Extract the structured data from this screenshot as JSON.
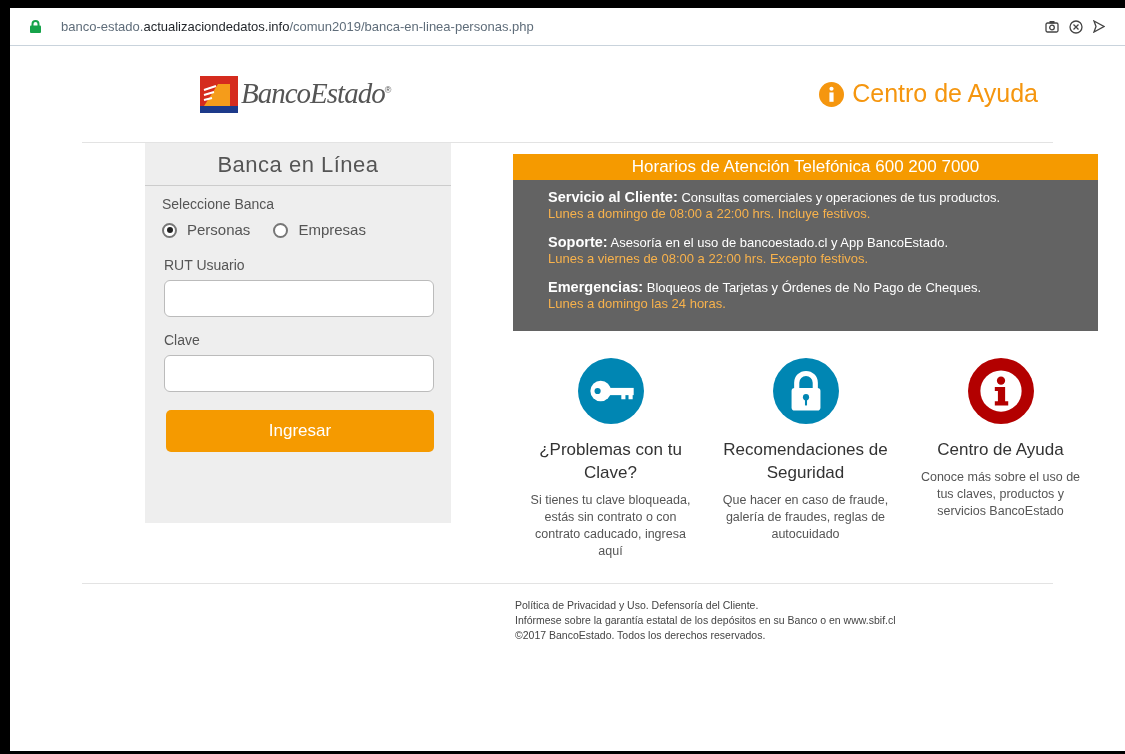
{
  "address_bar": {
    "secure": true,
    "url": [
      {
        "text": "banco-estado.",
        "emphasis": false
      },
      {
        "text": "actualizaciondedatos.info",
        "emphasis": true
      },
      {
        "text": "/comun2019/banca-en-linea-personas.php",
        "emphasis": false
      }
    ]
  },
  "header": {
    "logo_text": "BancoEstado",
    "logo_mark": "®",
    "help_link": "Centro de Ayuda"
  },
  "login": {
    "title": "Banca en Línea",
    "bank_label": "Seleccione Banca",
    "options": [
      {
        "label": "Personas",
        "selected": true
      },
      {
        "label": "Empresas",
        "selected": false
      }
    ],
    "fields": [
      {
        "label": "RUT Usuario"
      },
      {
        "label": "Clave"
      }
    ],
    "submit": "Ingresar"
  },
  "hours": {
    "title": "Horarios de Atención Telefónica 600 200 7000",
    "items": [
      {
        "name": "Servicio al Cliente:",
        "text": "Consultas comerciales y operaciones de tus productos.",
        "schedule": "Lunes a domingo de 08:00 a 22:00 hrs. Incluye festivos."
      },
      {
        "name": "Soporte:",
        "text": "Asesoría en el uso de bancoestado.cl y App BancoEstado.",
        "schedule": "Lunes a viernes de 08:00 a 22:00 hrs. Excepto festivos."
      },
      {
        "name": "Emergencias:",
        "text": "Bloqueos de Tarjetas y Órdenes de No Pago de Cheques.",
        "schedule": "Lunes a domingo las 24 horas."
      }
    ]
  },
  "features": [
    {
      "kind": "key",
      "color": "#0086b3",
      "title": "¿Problemas con tu Clave?",
      "text": "Si tienes tu clave bloqueada, estás sin contrato o con contrato caducado, ingresa aquí"
    },
    {
      "kind": "lock",
      "color": "#0086b3",
      "title": "Recomendaciones de Seguridad",
      "text": "Que hacer en caso de fraude, galería de fraudes, reglas de autocuidado"
    },
    {
      "kind": "info",
      "color": "#b30000",
      "title": "Centro de Ayuda",
      "text": "Conoce más sobre el uso de tus claves, productos y servicios BancoEstado"
    }
  ],
  "footer": [
    "Política de Privacidad y Uso. Defensoría del Cliente.",
    "Infórmese sobre la garantía estatal de los depósitos en su Banco o en www.sbif.cl",
    "©2017 BancoEstado. Todos los derechos reservados."
  ]
}
